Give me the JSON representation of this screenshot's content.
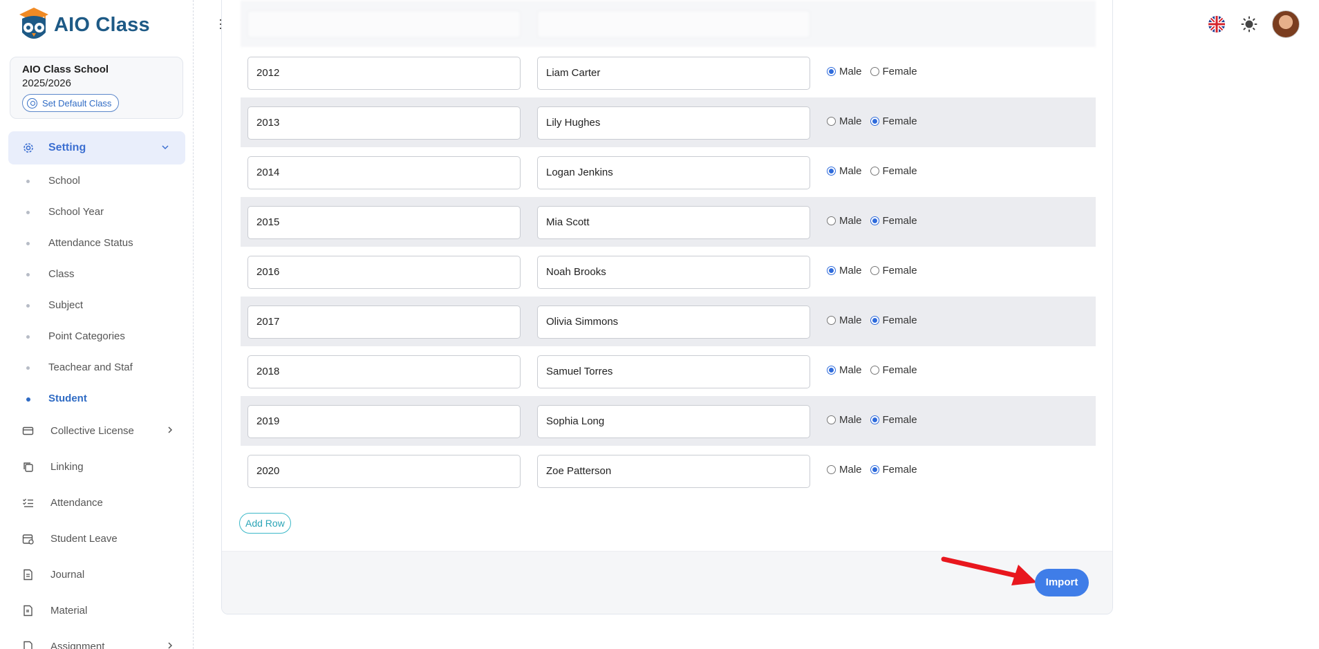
{
  "app": {
    "name": "AIO Class"
  },
  "school": {
    "name": "AIO Class School",
    "year": "2025/2026",
    "default_class_label": "Set Default Class"
  },
  "sidebar": {
    "setting_label": "Setting",
    "sub_items": [
      {
        "label": "School",
        "active": false
      },
      {
        "label": "School Year",
        "active": false
      },
      {
        "label": "Attendance Status",
        "active": false
      },
      {
        "label": "Class",
        "active": false
      },
      {
        "label": "Subject",
        "active": false
      },
      {
        "label": "Point Categories",
        "active": false
      },
      {
        "label": "Teachear and Staf",
        "active": false
      },
      {
        "label": "Student",
        "active": true
      }
    ],
    "menu": [
      {
        "label": "Collective License",
        "icon": "card-icon",
        "has_arrow": true
      },
      {
        "label": "Linking",
        "icon": "copy-icon",
        "has_arrow": false
      },
      {
        "label": "Attendance",
        "icon": "checklist-icon",
        "has_arrow": false
      },
      {
        "label": "Student Leave",
        "icon": "calendar-icon",
        "has_arrow": false
      },
      {
        "label": "Journal",
        "icon": "document-icon",
        "has_arrow": false
      },
      {
        "label": "Material",
        "icon": "file-icon",
        "has_arrow": false
      },
      {
        "label": "Assignment",
        "icon": "assignment-icon",
        "has_arrow": true
      }
    ]
  },
  "students": {
    "gender_options": [
      "Male",
      "Female"
    ],
    "rows": [
      {
        "id": "2012",
        "name": "Liam Carter",
        "gender": "Male"
      },
      {
        "id": "2013",
        "name": "Lily Hughes",
        "gender": "Female"
      },
      {
        "id": "2014",
        "name": "Logan Jenkins",
        "gender": "Male"
      },
      {
        "id": "2015",
        "name": "Mia Scott",
        "gender": "Female"
      },
      {
        "id": "2016",
        "name": "Noah Brooks",
        "gender": "Male"
      },
      {
        "id": "2017",
        "name": "Olivia Simmons",
        "gender": "Female"
      },
      {
        "id": "2018",
        "name": "Samuel Torres",
        "gender": "Male"
      },
      {
        "id": "2019",
        "name": "Sophia Long",
        "gender": "Female"
      },
      {
        "id": "2020",
        "name": "Zoe Patterson",
        "gender": "Female"
      }
    ]
  },
  "actions": {
    "add_row": "Add Row",
    "import": "Import"
  },
  "colors": {
    "accent": "#3f7de8",
    "sidebar_active_bg": "#e9eefb",
    "add_row": "#2aa4b6",
    "arrow": "#e8171e"
  }
}
